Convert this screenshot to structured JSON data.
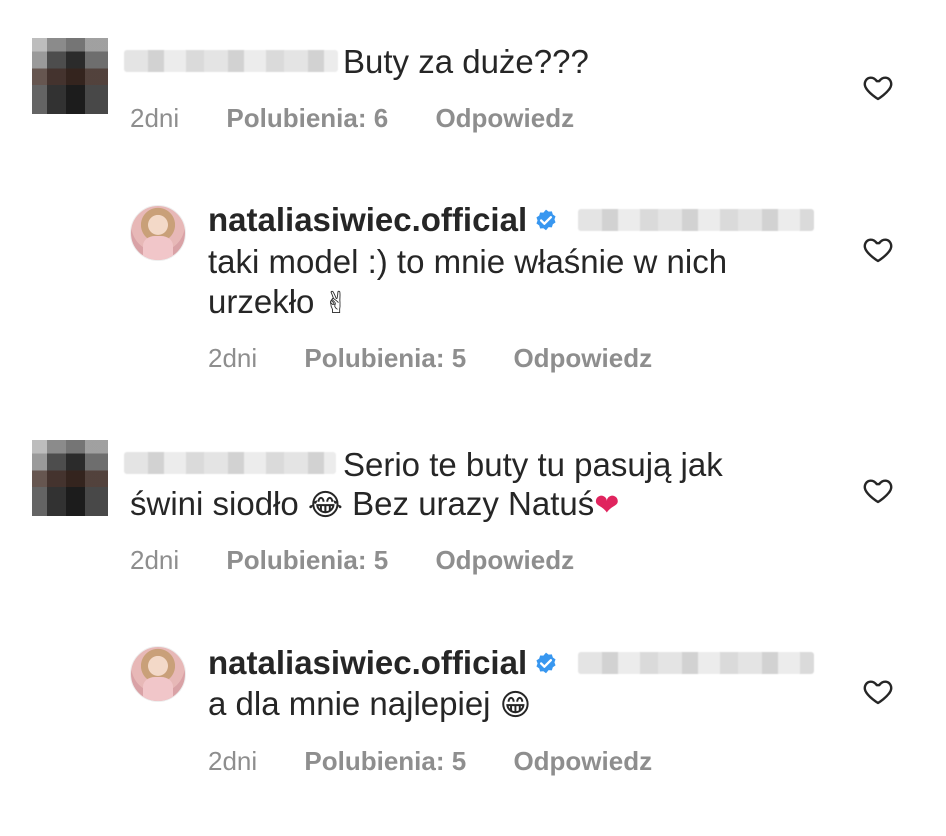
{
  "comments": [
    {
      "username": "",
      "text": "Buty za duże???",
      "time": "2dni",
      "likes": "Polubienia: 6",
      "reply": "Odpowiedz"
    },
    {
      "username": "nataliasiwiec.official",
      "text_line1": "taki model :) to mnie właśnie w nich",
      "text_line2": "urzekło",
      "emoji": "✌",
      "time": "2dni",
      "likes": "Polubienia: 5",
      "reply": "Odpowiedz"
    },
    {
      "username": "",
      "text_line1": "Serio te buty tu pasują jak",
      "text_line2a": "świni siodło",
      "emoji1": "😂",
      "text_line2b": "Bez urazy Natuś",
      "emoji2": "❤",
      "time": "2dni",
      "likes": "Polubienia: 5",
      "reply": "Odpowiedz"
    },
    {
      "username": "nataliasiwiec.official",
      "text": "a dla mnie najlepiej",
      "emoji": "😁",
      "time": "2dni",
      "likes": "Polubienia: 5",
      "reply": "Odpowiedz"
    }
  ],
  "icons": {
    "heart": "heart-outline-icon",
    "verified": "verified-badge-icon"
  },
  "colors": {
    "text": "#262626",
    "meta": "#8e8e8e",
    "verified": "#3897f0",
    "heart_red": "#e0245e"
  }
}
